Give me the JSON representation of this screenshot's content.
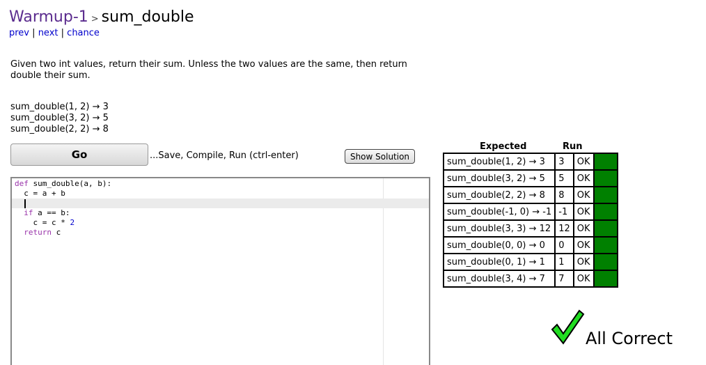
{
  "header": {
    "section": "Warmup-1",
    "separator": ">",
    "problem": "sum_double"
  },
  "nav": {
    "prev": "prev",
    "next": "next",
    "chance": "chance",
    "sep": "|"
  },
  "description": "Given two int values, return their sum. Unless the two values are the same, then return double their sum.",
  "examples": [
    "sum_double(1, 2) → 3",
    "sum_double(3, 2) → 5",
    "sum_double(2, 2) → 8"
  ],
  "toolbar": {
    "go": "Go",
    "hint": "...Save, Compile, Run (ctrl-enter)",
    "show_solution": "Show Solution"
  },
  "code": {
    "l1_kw": "def",
    "l1": " sum_double(a, b):",
    "l2": "  c = a + b",
    "l4_kw": "if",
    "l4": " a == b:",
    "l5": "    c = c * ",
    "l5_num": "2",
    "l6_kw": "return",
    "l6": " c"
  },
  "results": {
    "headers": {
      "expected": "Expected",
      "run": "Run"
    },
    "rows": [
      {
        "expected": "sum_double(1, 2) → 3",
        "run": "3",
        "status": "OK"
      },
      {
        "expected": "sum_double(3, 2) → 5",
        "run": "5",
        "status": "OK"
      },
      {
        "expected": "sum_double(2, 2) → 8",
        "run": "8",
        "status": "OK"
      },
      {
        "expected": "sum_double(-1, 0) → -1",
        "run": "-1",
        "status": "OK"
      },
      {
        "expected": "sum_double(3, 3) → 12",
        "run": "12",
        "status": "OK"
      },
      {
        "expected": "sum_double(0, 0) → 0",
        "run": "0",
        "status": "OK"
      },
      {
        "expected": "sum_double(0, 1) → 1",
        "run": "1",
        "status": "OK"
      },
      {
        "expected": "sum_double(3, 4) → 7",
        "run": "7",
        "status": "OK"
      }
    ],
    "pass_color": "#008000"
  },
  "summary": "All Correct"
}
